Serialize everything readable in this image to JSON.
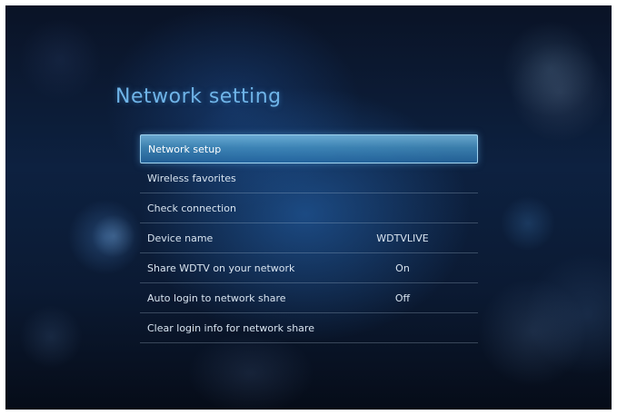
{
  "screen": {
    "title": "Network setting"
  },
  "menu": {
    "items": [
      {
        "label": "Network setup",
        "value": "",
        "selected": true
      },
      {
        "label": "Wireless favorites",
        "value": ""
      },
      {
        "label": "Check connection",
        "value": ""
      },
      {
        "label": "Device name",
        "value": "WDTVLIVE"
      },
      {
        "label": "Share WDTV on your network",
        "value": "On"
      },
      {
        "label": "Auto login to network share",
        "value": "Off"
      },
      {
        "label": "Clear login info for network share",
        "value": ""
      }
    ]
  },
  "colors": {
    "title": "#6fb4e8",
    "highlight": "#5aa0d0",
    "background": "#0d2140",
    "text": "#d8e4f0"
  }
}
